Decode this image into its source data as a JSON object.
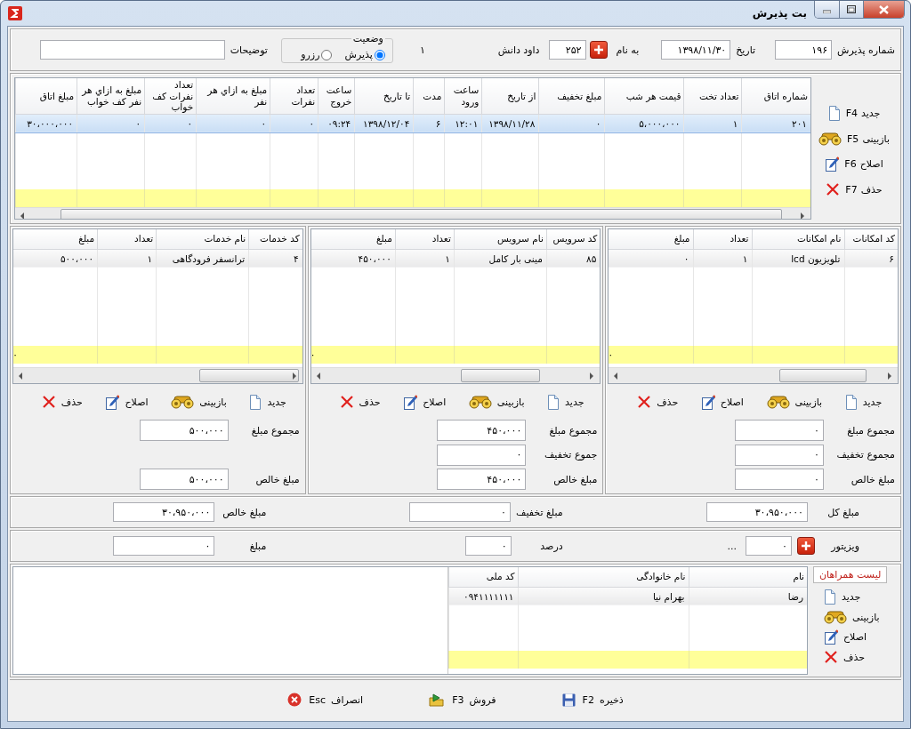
{
  "window": {
    "title": "بت پذیرش"
  },
  "header": {
    "reception_number": {
      "label": "شماره پذیرش",
      "value": "۱۹۶"
    },
    "date": {
      "label": "تاریخ",
      "value": "۱۳۹۸/۱۱/۳۰"
    },
    "guest": {
      "label": "به نام",
      "code": "۲۵۲",
      "name": "داود دانش"
    },
    "count": "۱",
    "status": {
      "title": "وضعیت",
      "options": [
        {
          "label": "پذیرش",
          "selected": true
        },
        {
          "label": "رزرو",
          "selected": false
        }
      ]
    },
    "notes": {
      "label": "توضیحات"
    }
  },
  "rooms": {
    "actions": [
      {
        "kind": "new",
        "label": "جدید",
        "key": "F4"
      },
      {
        "kind": "view",
        "label": "بازبینی",
        "key": "F5"
      },
      {
        "kind": "edit",
        "label": "اصلاح",
        "key": "F6"
      },
      {
        "kind": "delete",
        "label": "حذف",
        "key": "F7"
      }
    ],
    "columns": [
      "شماره اتاق",
      "تعداد تخت",
      "قیمت هر شب",
      "مبلغ تخفیف",
      "از تاریخ",
      "ساعت ورود",
      "مدت",
      "تا تاریخ",
      "ساعت خروج",
      "تعداد نفرات",
      "مبلغ به ازاي هر نفر",
      "تعداد نفرات کف خواب",
      "مبلغ به ازاي هر نفر کف خواب",
      "مبلغ اتاق"
    ],
    "rows": [
      {
        "cells": [
          "۲۰۱",
          "۱",
          "۵،۰۰۰،۰۰۰",
          "۰",
          "۱۳۹۸/۱۱/۲۸",
          "۱۲:۰۱",
          "۶",
          "۱۳۹۸/۱۲/۰۴",
          "۰۹:۲۴",
          "۰",
          "۰",
          "۰",
          "۰",
          "۳۰،۰۰۰،۰۰۰"
        ],
        "selected": true
      }
    ]
  },
  "panels": [
    {
      "columns": [
        "کد امکانات",
        "نام امکانات",
        "تعداد",
        "مبلغ"
      ],
      "rows": [
        {
          "cells": [
            "۶",
            "تلویزیون lcd",
            "۱",
            "۰"
          ],
          "selected": false
        }
      ],
      "footer_total": "۰",
      "actions": [
        {
          "kind": "new",
          "label": "جدید"
        },
        {
          "kind": "view",
          "label": "بازبینی"
        },
        {
          "kind": "edit",
          "label": "اصلاح"
        },
        {
          "kind": "delete",
          "label": "حذف"
        }
      ],
      "totals": [
        {
          "label": "مجموع مبلغ",
          "value": "۰"
        },
        {
          "label": "مجموع تخفیف",
          "value": "۰"
        },
        {
          "label": "مبلغ خالص",
          "value": "۰"
        }
      ]
    },
    {
      "columns": [
        "کد سرویس",
        "نام سرویس",
        "تعداد",
        "مبلغ"
      ],
      "rows": [
        {
          "cells": [
            "۸۵",
            "مینی بار کامل",
            "۱",
            "۴۵۰،۰۰۰"
          ],
          "selected": false
        }
      ],
      "footer_total": "۰",
      "actions": [
        {
          "kind": "new",
          "label": "جدید"
        },
        {
          "kind": "view",
          "label": "بازبینی"
        },
        {
          "kind": "edit",
          "label": "اصلاح"
        },
        {
          "kind": "delete",
          "label": "حذف"
        }
      ],
      "totals": [
        {
          "label": "مجموع مبلغ",
          "value": "۴۵۰،۰۰۰"
        },
        {
          "label": "جموع تخفیف",
          "value": "۰"
        },
        {
          "label": "مبلغ خالص",
          "value": "۴۵۰،۰۰۰"
        }
      ]
    },
    {
      "columns": [
        "کد خدمات",
        "نام خدمات",
        "تعداد",
        "مبلغ"
      ],
      "rows": [
        {
          "cells": [
            "۴",
            "ترانسفر فرودگاهی",
            "۱",
            "۵۰۰،۰۰۰"
          ],
          "selected": false
        }
      ],
      "footer_total": "۰",
      "actions": [
        {
          "kind": "new",
          "label": "جدید"
        },
        {
          "kind": "view",
          "label": "بازبینی"
        },
        {
          "kind": "edit",
          "label": "اصلاح"
        },
        {
          "kind": "delete",
          "label": "حذف"
        }
      ],
      "totals": [
        {
          "label": "مجموع مبلغ",
          "value": "۵۰۰،۰۰۰"
        },
        {
          "label": "مبلغ خالص",
          "value": "۵۰۰،۰۰۰"
        }
      ]
    }
  ],
  "summary": [
    {
      "label": "مبلغ کل",
      "value": "۳۰،۹۵۰،۰۰۰"
    },
    {
      "label": "مبلغ تخفیف",
      "value": "۰"
    },
    {
      "label": "مبلغ خالص",
      "value": "۳۰،۹۵۰،۰۰۰"
    }
  ],
  "visitor": {
    "label": "ویزیتور",
    "value": "۰",
    "more": "...",
    "percent": {
      "label": "درصد",
      "value": "۰"
    },
    "amount": {
      "label": "مبلغ",
      "value": "۰"
    }
  },
  "companions": {
    "title": "لیست همراهان",
    "actions": [
      {
        "kind": "new",
        "label": "جدید"
      },
      {
        "kind": "view",
        "label": "بازبینی"
      },
      {
        "kind": "edit",
        "label": "اصلاح"
      },
      {
        "kind": "delete",
        "label": "حذف"
      }
    ],
    "columns": [
      "نام",
      "نام خانوادگی",
      "کد ملی"
    ],
    "rows": [
      {
        "cells": [
          "رضا",
          "بهرام نیا",
          "۰۹۴۱۱۱۱۱۱۱"
        ],
        "selected": false
      }
    ]
  },
  "footer_actions": [
    {
      "kind": "save",
      "label": "ذخیره",
      "key": "F2"
    },
    {
      "kind": "sell",
      "label": "فروش",
      "key": "F3"
    },
    {
      "kind": "cancel",
      "label": "انصراف",
      "key": "Esc"
    }
  ]
}
